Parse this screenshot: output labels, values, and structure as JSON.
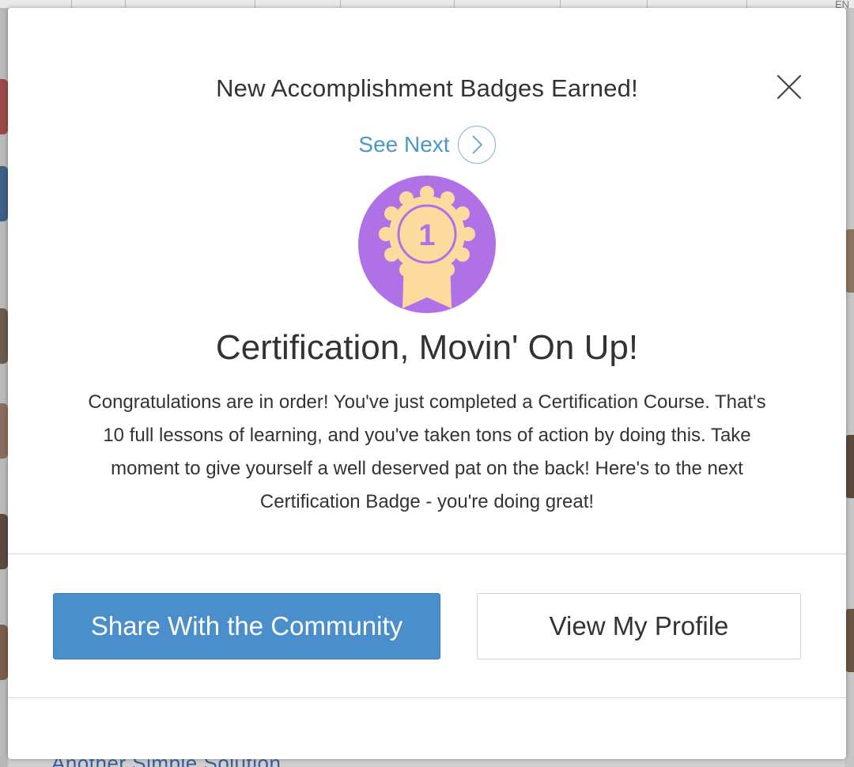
{
  "background": {
    "corner_text": "EN",
    "bottom_text": "Another Simple Solution"
  },
  "modal": {
    "title": "New Accomplishment Badges Earned!",
    "close_icon": "close-icon",
    "see_next_label": "See Next",
    "see_next_icon": "chevron-right-icon",
    "badge": {
      "number": "1",
      "icon": "ribbon-award-icon",
      "circle_color": "#b071e6",
      "ribbon_color": "#fddb9e"
    },
    "badge_title": "Certification, Movin' On Up!",
    "badge_description": "Congratulations are in order! You've just completed a Certification Course. That's 10 full lessons of learning, and you've taken tons of action by doing this. Take moment to give yourself a well deserved pat on the back! Here's to the next Certification Badge - you're doing great!",
    "buttons": {
      "share_label": "Share With the Community",
      "profile_label": "View My Profile"
    },
    "accent_color": "#4a8fcc"
  }
}
